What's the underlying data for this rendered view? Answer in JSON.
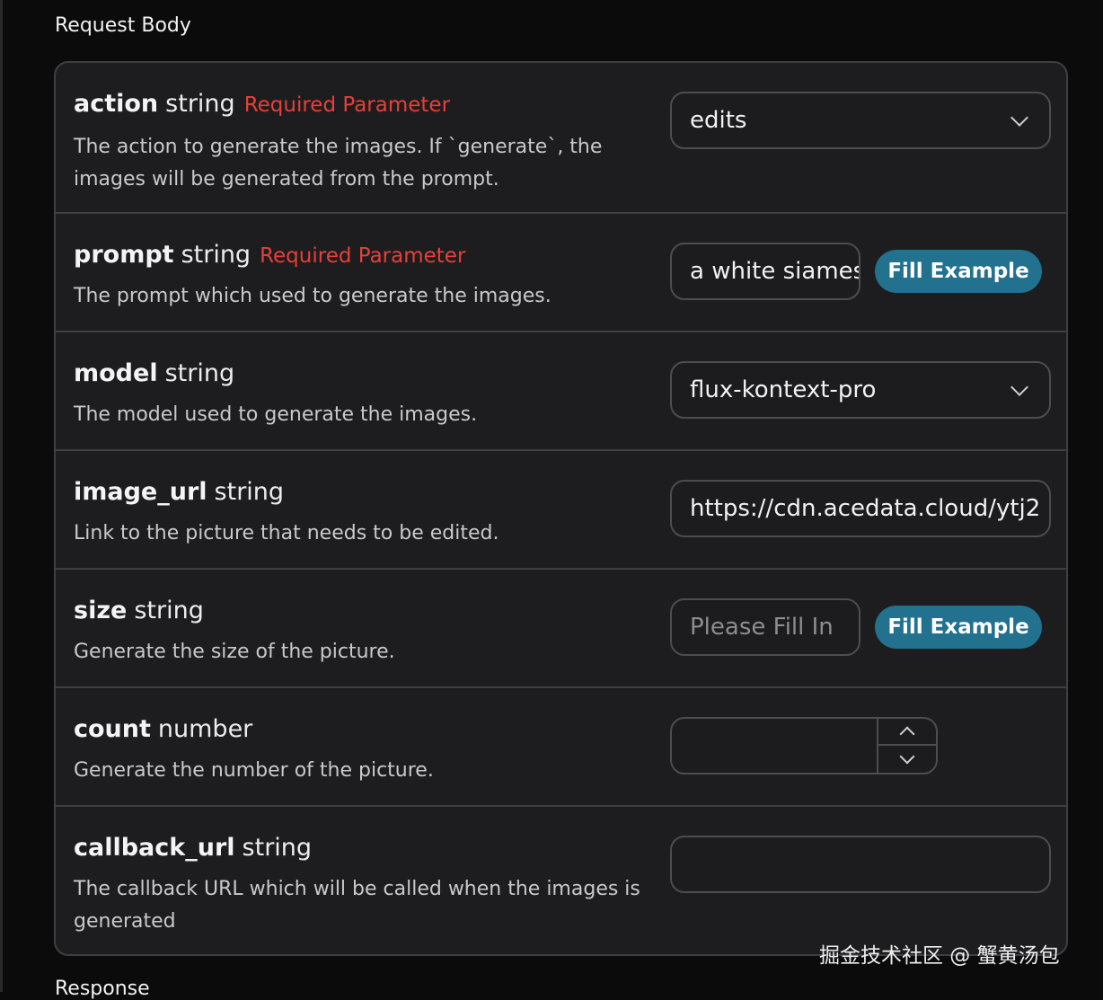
{
  "section_title": "Request Body",
  "bottom_title": "Response",
  "params": [
    {
      "name": "action",
      "type": "string",
      "required_label": "Required Parameter",
      "description": "The action to generate the images. If `generate`, the images will be generated from the prompt.",
      "control": "select",
      "value": "edits"
    },
    {
      "name": "prompt",
      "type": "string",
      "required_label": "Required Parameter",
      "description": "The prompt which used to generate the images.",
      "control": "text",
      "value": "a white siamese",
      "button": "Fill Example"
    },
    {
      "name": "model",
      "type": "string",
      "description": "The model used to generate the images.",
      "control": "select",
      "value": "flux-kontext-pro"
    },
    {
      "name": "image_url",
      "type": "string",
      "description": "Link to the picture that needs to be edited.",
      "control": "text",
      "value": "https://cdn.acedata.cloud/ytj2"
    },
    {
      "name": "size",
      "type": "string",
      "description": "Generate the size of the picture.",
      "control": "text",
      "placeholder": "Please Fill In",
      "button": "Fill Example"
    },
    {
      "name": "count",
      "type": "number",
      "description": "Generate the number of the picture.",
      "control": "number",
      "value": ""
    },
    {
      "name": "callback_url",
      "type": "string",
      "description": "The callback URL which will be called when the images is generated",
      "control": "text",
      "value": ""
    }
  ],
  "watermark": "掘金技术社区 @ 蟹黄汤包",
  "icons": {
    "select": "chevron-down-icon",
    "up": "chevron-up-icon",
    "down": "chevron-down-icon"
  },
  "colors": {
    "accent": "#22718f",
    "required": "#e5403a",
    "background": "#1d1d1f"
  }
}
